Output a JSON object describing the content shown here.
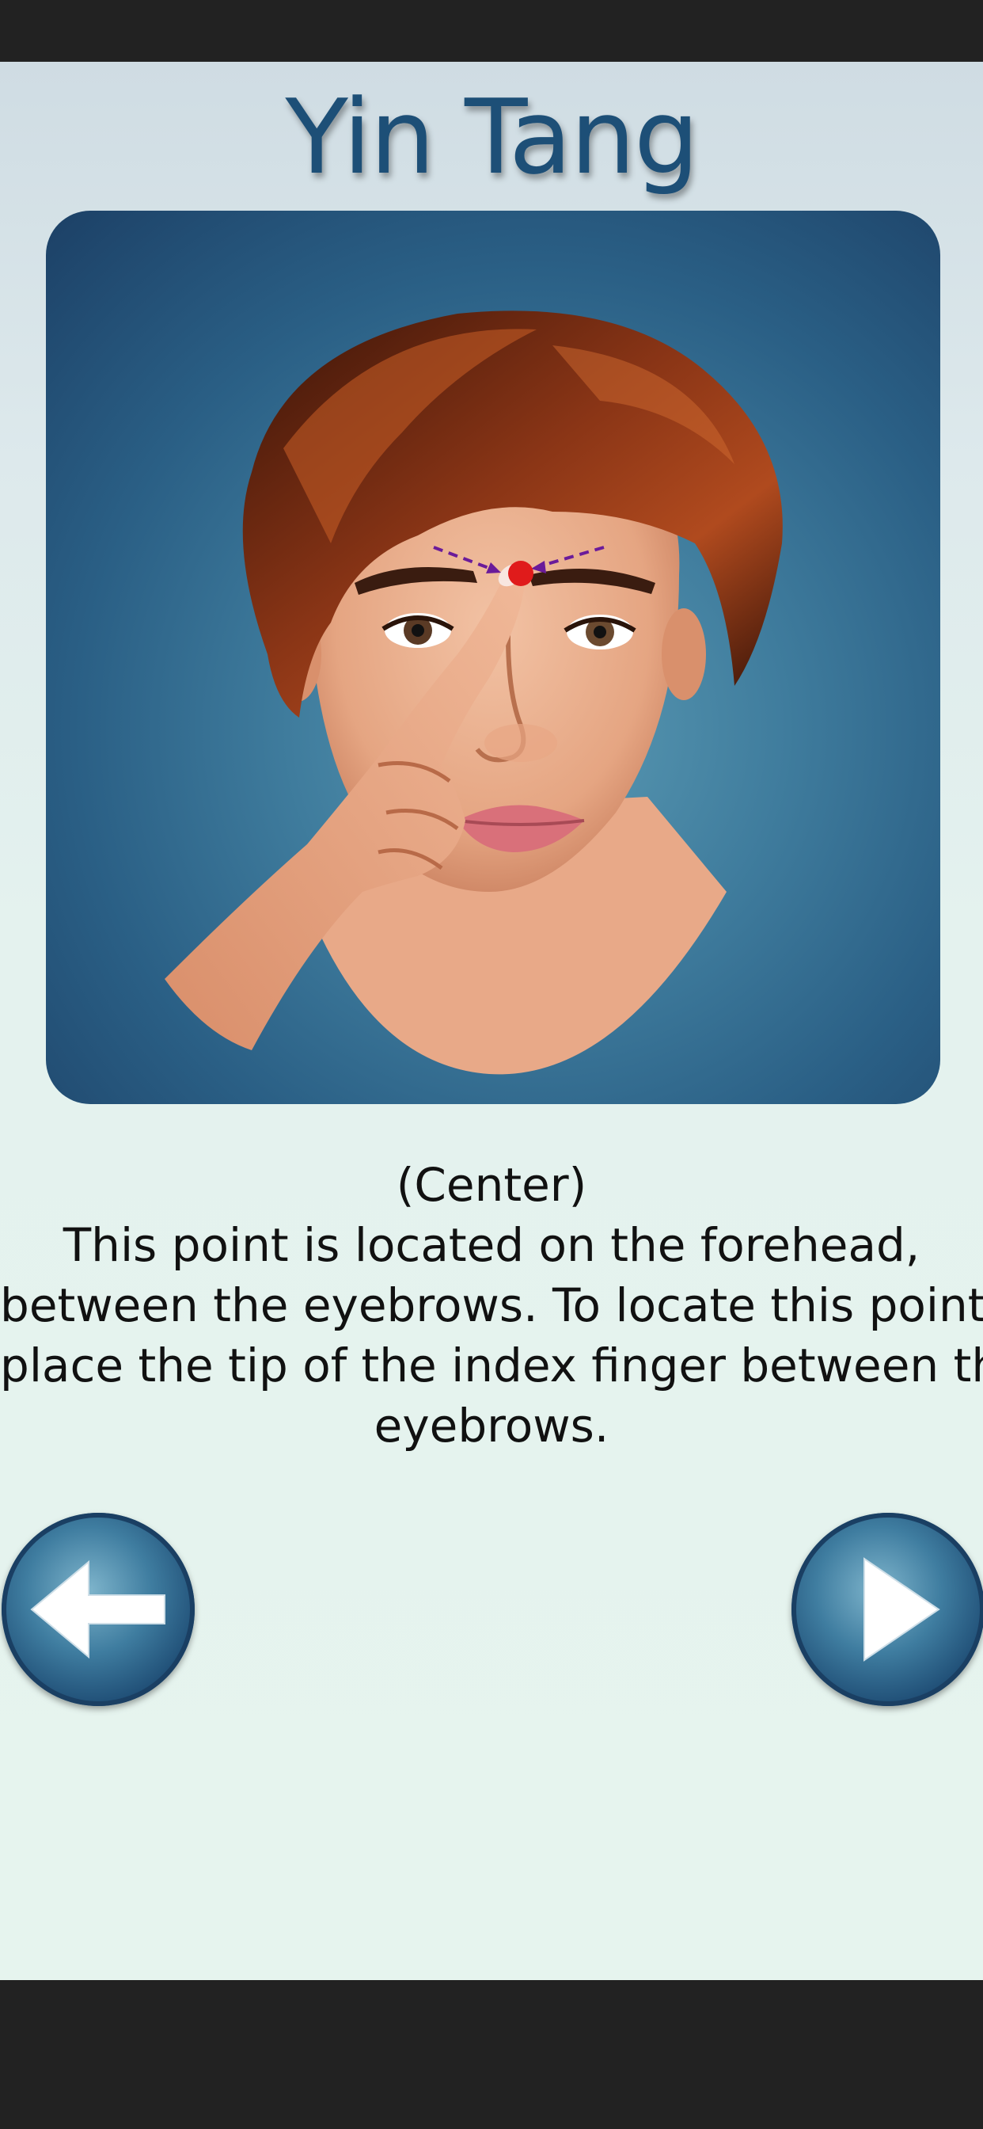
{
  "title": "Yin Tang",
  "subtitle": "(Center)",
  "description_lines": [
    "This point is located on the forehead,",
    "between the eyebrows. To locate this point,",
    "place the tip of the index finger between the",
    "eyebrows."
  ],
  "icons": {
    "previous": "arrow-left-icon",
    "next": "play-right-icon"
  },
  "colors": {
    "title": "#1d4f77",
    "background": "#e6f4ee",
    "illustration_bg": "#2a5f85",
    "point_marker": "#e01b1b",
    "guide_arrow": "#6a1b9a"
  }
}
